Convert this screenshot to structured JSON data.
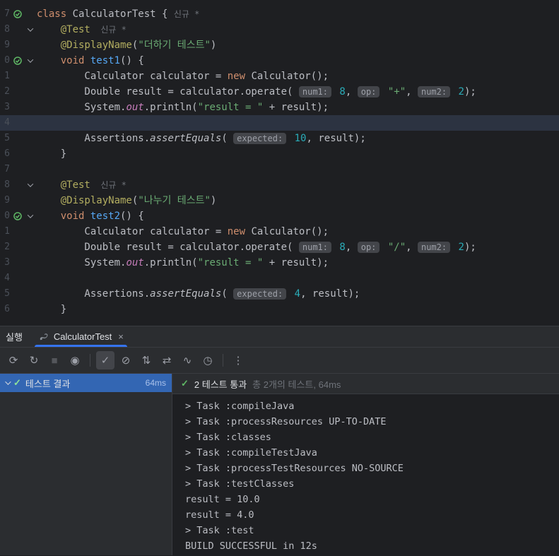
{
  "colors": {
    "accent": "#3574f0",
    "selection": "#3366b3",
    "pass_green": "#5fb865",
    "caret_line": "#2c3341"
  },
  "editor": {
    "lines": [
      {
        "n": "7",
        "icon": "test-pass-icon",
        "fold": false,
        "caret": false,
        "tokens": [
          {
            "c": "kw",
            "t": "class "
          },
          {
            "c": "pl",
            "t": "CalculatorTest { "
          },
          {
            "c": "vhint",
            "t": "신규 *"
          }
        ]
      },
      {
        "n": "8",
        "fold": true,
        "tokens": [
          {
            "c": "pl",
            "t": "    "
          },
          {
            "c": "ann",
            "t": "@Test"
          },
          {
            "c": "vhint",
            "t": "  신규 *"
          }
        ]
      },
      {
        "n": "9",
        "tokens": [
          {
            "c": "pl",
            "t": "    "
          },
          {
            "c": "ann",
            "t": "@DisplayName"
          },
          {
            "c": "pl",
            "t": "("
          },
          {
            "c": "str",
            "t": "\"더하기 테스트\""
          },
          {
            "c": "pl",
            "t": ")"
          }
        ]
      },
      {
        "n": "0",
        "icon": "test-pass-icon",
        "fold": true,
        "tokens": [
          {
            "c": "pl",
            "t": "    "
          },
          {
            "c": "kw",
            "t": "void "
          },
          {
            "c": "fn",
            "t": "test1"
          },
          {
            "c": "pl",
            "t": "() {"
          }
        ]
      },
      {
        "n": "1",
        "tokens": [
          {
            "c": "pl",
            "t": "        Calculator calculator = "
          },
          {
            "c": "kw",
            "t": "new"
          },
          {
            "c": "pl",
            "t": " Calculator();"
          }
        ]
      },
      {
        "n": "2",
        "tokens": [
          {
            "c": "pl",
            "t": "        Double result = calculator.operate( "
          },
          {
            "c": "chip",
            "t": "num1:"
          },
          {
            "c": "num",
            "t": " 8"
          },
          {
            "c": "pl",
            "t": ", "
          },
          {
            "c": "chip",
            "t": "op:"
          },
          {
            "c": "str",
            "t": " \"+\""
          },
          {
            "c": "pl",
            "t": ", "
          },
          {
            "c": "chip",
            "t": "num2:"
          },
          {
            "c": "num",
            "t": " 2"
          },
          {
            "c": "pl",
            "t": ");"
          }
        ]
      },
      {
        "n": "3",
        "tokens": [
          {
            "c": "pl",
            "t": "        System."
          },
          {
            "c": "fld",
            "t": "out"
          },
          {
            "c": "pl",
            "t": ".println("
          },
          {
            "c": "str",
            "t": "\"result = \""
          },
          {
            "c": "pl",
            "t": " + result);"
          }
        ]
      },
      {
        "n": "4",
        "caret": true,
        "tokens": []
      },
      {
        "n": "5",
        "tokens": [
          {
            "c": "pl",
            "t": "        Assertions."
          },
          {
            "c": "fni",
            "t": "assertEquals"
          },
          {
            "c": "pl",
            "t": "( "
          },
          {
            "c": "chip",
            "t": "expected:"
          },
          {
            "c": "num",
            "t": " 10"
          },
          {
            "c": "pl",
            "t": ", result);"
          }
        ]
      },
      {
        "n": "6",
        "tokens": [
          {
            "c": "pl",
            "t": "    }"
          }
        ]
      },
      {
        "n": "7",
        "tokens": []
      },
      {
        "n": "8",
        "fold": true,
        "tokens": [
          {
            "c": "pl",
            "t": "    "
          },
          {
            "c": "ann",
            "t": "@Test"
          },
          {
            "c": "vhint",
            "t": "  신규 *"
          }
        ]
      },
      {
        "n": "9",
        "tokens": [
          {
            "c": "pl",
            "t": "    "
          },
          {
            "c": "ann",
            "t": "@DisplayName"
          },
          {
            "c": "pl",
            "t": "("
          },
          {
            "c": "str",
            "t": "\"나누기 테스트\""
          },
          {
            "c": "pl",
            "t": ")"
          }
        ]
      },
      {
        "n": "0",
        "icon": "test-pass-icon",
        "fold": true,
        "tokens": [
          {
            "c": "pl",
            "t": "    "
          },
          {
            "c": "kw",
            "t": "void "
          },
          {
            "c": "fn",
            "t": "test2"
          },
          {
            "c": "pl",
            "t": "() {"
          }
        ]
      },
      {
        "n": "1",
        "tokens": [
          {
            "c": "pl",
            "t": "        Calculator calculator = "
          },
          {
            "c": "kw",
            "t": "new"
          },
          {
            "c": "pl",
            "t": " Calculator();"
          }
        ]
      },
      {
        "n": "2",
        "tokens": [
          {
            "c": "pl",
            "t": "        Double result = calculator.operate( "
          },
          {
            "c": "chip",
            "t": "num1:"
          },
          {
            "c": "num",
            "t": " 8"
          },
          {
            "c": "pl",
            "t": ", "
          },
          {
            "c": "chip",
            "t": "op:"
          },
          {
            "c": "str",
            "t": " \"/\""
          },
          {
            "c": "pl",
            "t": ", "
          },
          {
            "c": "chip",
            "t": "num2:"
          },
          {
            "c": "num",
            "t": " 2"
          },
          {
            "c": "pl",
            "t": ");"
          }
        ]
      },
      {
        "n": "3",
        "tokens": [
          {
            "c": "pl",
            "t": "        System."
          },
          {
            "c": "fld",
            "t": "out"
          },
          {
            "c": "pl",
            "t": ".println("
          },
          {
            "c": "str",
            "t": "\"result = \""
          },
          {
            "c": "pl",
            "t": " + result);"
          }
        ]
      },
      {
        "n": "4",
        "tokens": []
      },
      {
        "n": "5",
        "tokens": [
          {
            "c": "pl",
            "t": "        Assertions."
          },
          {
            "c": "fni",
            "t": "assertEquals"
          },
          {
            "c": "pl",
            "t": "( "
          },
          {
            "c": "chip",
            "t": "expected:"
          },
          {
            "c": "num",
            "t": " 4"
          },
          {
            "c": "pl",
            "t": ", result);"
          }
        ]
      },
      {
        "n": "6",
        "tokens": [
          {
            "c": "pl",
            "t": "    }"
          }
        ]
      }
    ]
  },
  "run_panel": {
    "window_label": "실행",
    "tab": {
      "title": "CalculatorTest",
      "close_label": "×"
    },
    "toolbar": [
      {
        "name": "rerun-icon",
        "glyph": "⟳"
      },
      {
        "name": "rerun-failed-tests-icon",
        "glyph": "↻"
      },
      {
        "name": "stop-icon",
        "glyph": "■",
        "state": "disabled"
      },
      {
        "name": "toggle-auto-test-icon",
        "glyph": "◉"
      },
      {
        "name": "separator"
      },
      {
        "name": "show-passed-icon",
        "glyph": "✓",
        "state": "toggled"
      },
      {
        "name": "show-ignored-icon",
        "glyph": "⊘"
      },
      {
        "name": "sort-by-duration-icon",
        "glyph": "⇅"
      },
      {
        "name": "expand-all-icon",
        "glyph": "⇄"
      },
      {
        "name": "show-statistics-icon",
        "glyph": "∿"
      },
      {
        "name": "test-history-icon",
        "glyph": "◷"
      },
      {
        "name": "separator"
      },
      {
        "name": "more-options-icon",
        "glyph": "⋮"
      }
    ],
    "tree": {
      "rows": [
        {
          "label": "테스트 결과",
          "duration": "64ms",
          "state": "passed",
          "selected": true
        }
      ]
    },
    "summary": {
      "status_label": "2 테스트 통과",
      "detail": "총 2개의 테스트, 64ms"
    },
    "console_lines": [
      "> Task :compileJava",
      "> Task :processResources UP-TO-DATE",
      "> Task :classes",
      "> Task :compileTestJava",
      "> Task :processTestResources NO-SOURCE",
      "> Task :testClasses",
      "result = 10.0",
      "result = 4.0",
      "> Task :test",
      "BUILD SUCCESSFUL in 12s"
    ]
  }
}
